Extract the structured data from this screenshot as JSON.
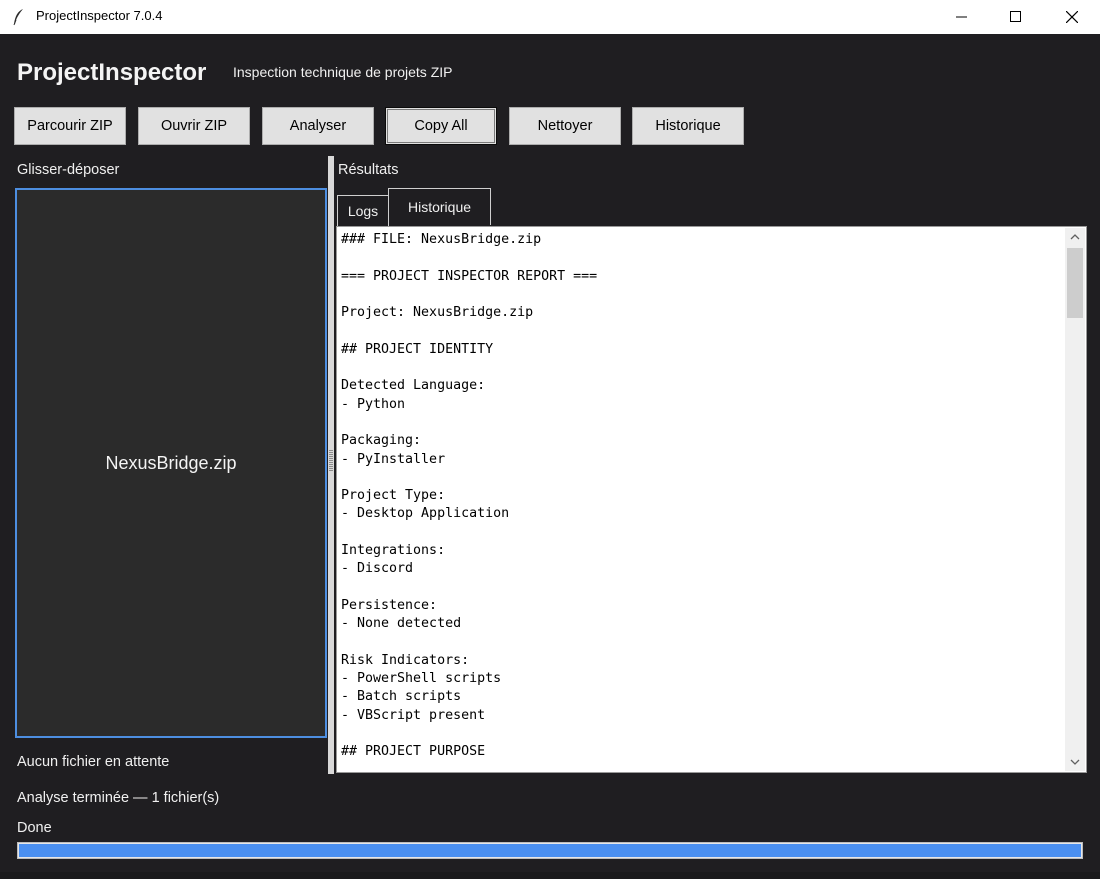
{
  "window": {
    "title": "ProjectInspector 7.0.4",
    "icons": [
      "feather-icon",
      "minimize-icon",
      "maximize-icon",
      "close-icon"
    ]
  },
  "header": {
    "app_name": "ProjectInspector",
    "subtitle": "Inspection technique de projets ZIP"
  },
  "toolbar": {
    "buttons": [
      "Parcourir ZIP",
      "Ouvrir ZIP",
      "Analyser",
      "Copy All",
      "Nettoyer",
      "Historique"
    ]
  },
  "left_panel": {
    "label": "Glisser-déposer",
    "dropzone_file": "NexusBridge.zip",
    "queue_status": "Aucun fichier en attente",
    "analysis_status": "Analyse terminée — 1 fichier(s)"
  },
  "results": {
    "label": "Résultats",
    "tabs": [
      "Logs",
      "Historique"
    ],
    "log_lines": [
      "### FILE: NexusBridge.zip",
      "",
      "=== PROJECT INSPECTOR REPORT ===",
      "",
      "Project: NexusBridge.zip",
      "",
      "## PROJECT IDENTITY",
      "",
      "Detected Language:",
      "- Python",
      "",
      "Packaging:",
      "- PyInstaller",
      "",
      "Project Type:",
      "- Desktop Application",
      "",
      "Integrations:",
      "- Discord",
      "",
      "Persistence:",
      "- None detected",
      "",
      "Risk Indicators:",
      "- PowerShell scripts",
      "- Batch scripts",
      "- VBScript present",
      "",
      "## PROJECT PURPOSE"
    ]
  },
  "footer": {
    "status": "Done",
    "progress": 1.0
  },
  "colors": {
    "background": "#1f1e21",
    "accent": "#4d8ee0",
    "progress": "#4a8ff0"
  }
}
